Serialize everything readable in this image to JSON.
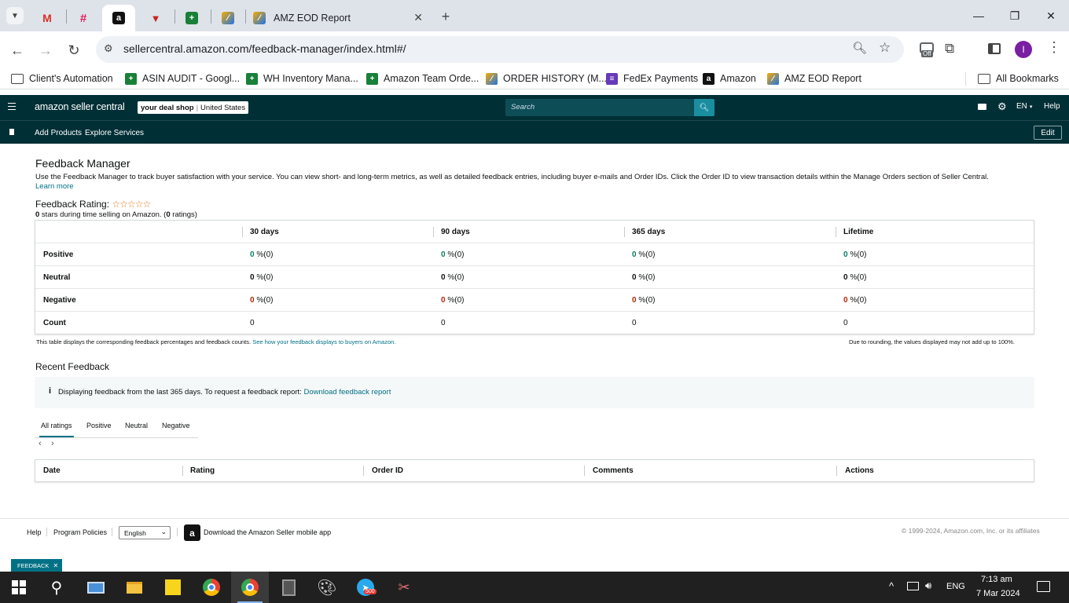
{
  "browser": {
    "active_tab_title": "AMZ EOD Report",
    "url": "sellercentral.amazon.com/feedback-manager/index.html#/",
    "extension_badge": "Off",
    "profile_initial": "I",
    "bookmarks": [
      "Client's Automation",
      "ASIN AUDIT - Googl...",
      "WH Inventory Mana...",
      "Amazon Team Orde...",
      "ORDER HISTORY (M...",
      "FedEx Payments",
      "Amazon",
      "AMZ EOD Report"
    ],
    "all_bookmarks": "All Bookmarks"
  },
  "header": {
    "logo": "amazon seller central",
    "store_name": "your deal shop",
    "marketplace": "United States",
    "search_placeholder": "Search",
    "language": "EN",
    "help": "Help",
    "nav": [
      "Add Products",
      "Explore Services"
    ],
    "edit": "Edit"
  },
  "feedback_manager": {
    "title": "Feedback Manager",
    "description": "Use the Feedback Manager to track buyer satisfaction with your service. You can view short- and long-term metrics, as well as detailed feedback entries, including buyer e-mails and Order IDs. Click the Order ID to view transaction details within the Manage Orders section of Seller Central.",
    "learn_more": "Learn more",
    "rating_label": "Feedback Rating:",
    "rating_stars": "☆☆☆☆☆",
    "rating_summary_count": "0",
    "rating_summary_mid": " stars during time selling on Amazon. (",
    "rating_summary_ratings": "0",
    "rating_summary_end": " ratings)",
    "columns": [
      "30 days",
      "90 days",
      "365 days",
      "Lifetime"
    ],
    "rows": {
      "positive": {
        "label": "Positive",
        "values": [
          "0",
          "0",
          "0",
          "0"
        ],
        "counts": [
          " %(0)",
          " %(0)",
          " %(0)",
          " %(0)"
        ]
      },
      "neutral": {
        "label": "Neutral",
        "values": [
          "0",
          "0",
          "0",
          "0"
        ],
        "counts": [
          " %(0)",
          " %(0)",
          " %(0)",
          " %(0)"
        ]
      },
      "negative": {
        "label": "Negative",
        "values": [
          "0",
          "0",
          "0",
          "0"
        ],
        "counts": [
          " %(0)",
          " %(0)",
          " %(0)",
          " %(0)"
        ]
      },
      "count": {
        "label": "Count",
        "values": [
          "0",
          "0",
          "0",
          "0"
        ]
      }
    },
    "table_note": "This table displays the corresponding feedback percentages and feedback counts. ",
    "table_note_link": "See how your feedback displays to buyers on Amazon.",
    "rounding_note": "Due to rounding, the values displayed may not add up to 100%."
  },
  "recent_feedback": {
    "title": "Recent Feedback",
    "info_text": "Displaying feedback from the last 365 days. To request a feedback report: ",
    "download_link": "Download feedback report",
    "tabs": [
      "All ratings",
      "Positive",
      "Neutral",
      "Negative"
    ],
    "columns": [
      "Date",
      "Rating",
      "Order ID",
      "Comments",
      "Actions"
    ]
  },
  "footer": {
    "help": "Help",
    "program_policies": "Program Policies",
    "language_selected": "English",
    "app_download": "Download the Amazon Seller mobile app",
    "copyright": "© 1999-2024, Amazon.com, Inc. or its affiliates",
    "feedback_tag": "FEEDBACK"
  },
  "taskbar": {
    "time": "7:13 am",
    "date": "7 Mar 2024",
    "lang": "ENG",
    "telegram_badge": "500"
  }
}
